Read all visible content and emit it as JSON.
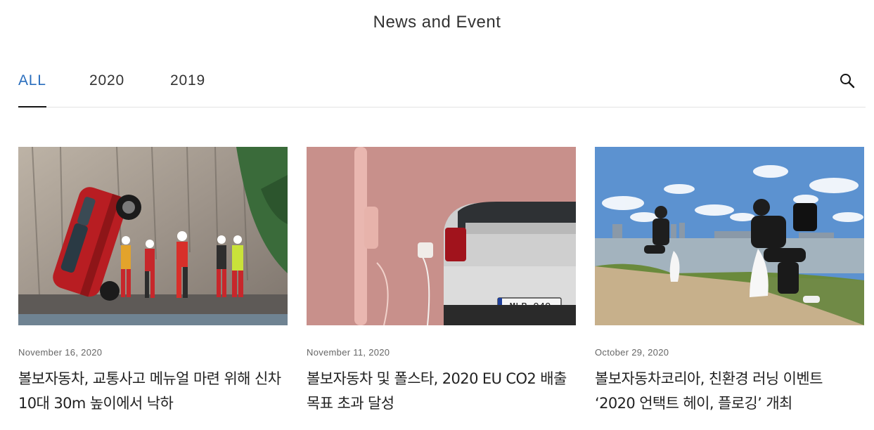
{
  "header": {
    "title": "News and Event"
  },
  "tabs": [
    {
      "label": "ALL",
      "active": true
    },
    {
      "label": "2020",
      "active": false
    },
    {
      "label": "2019",
      "active": false
    }
  ],
  "search": {
    "icon": "search-icon"
  },
  "articles": [
    {
      "date": "November 16, 2020",
      "title": "볼보자동차, 교통사고 메뉴얼 마련 위해 신차\n10대 30m 높이에서 낙하",
      "plate": ""
    },
    {
      "date": "November 11, 2020",
      "title": "볼보자동차 및 폴스타, 2020 EU CO2 배출\n목표 초과 달성",
      "plate": "MLB 040"
    },
    {
      "date": "October 29, 2020",
      "title": "볼보자동차코리아, 친환경 러닝 이벤트\n‘2020 언택트 헤이, 플로깅’ 개최",
      "plate": ""
    }
  ],
  "colors": {
    "active_tab": "#2a6ebd",
    "text": "#141414",
    "divider": "#e2e2e2"
  }
}
